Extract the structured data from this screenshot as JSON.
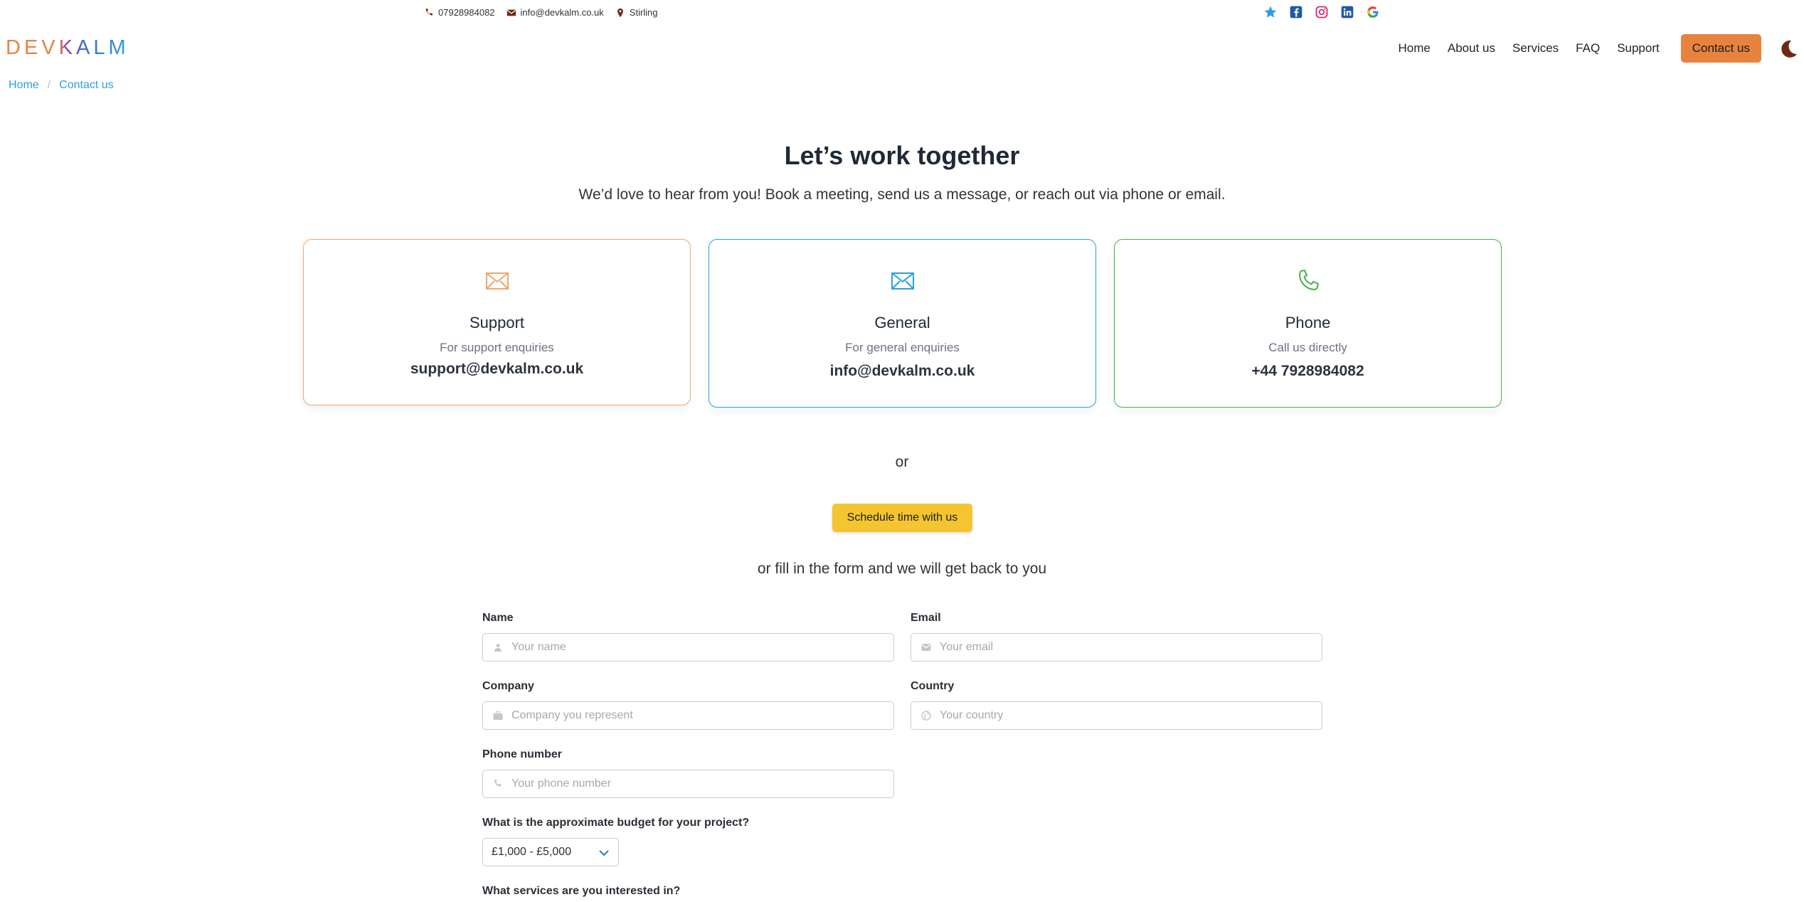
{
  "topbar": {
    "phone": "07928984082",
    "email": "info@devkalm.co.uk",
    "location": "Stirling",
    "social_icons": [
      "star-icon",
      "facebook-icon",
      "instagram-icon",
      "linkedin-icon",
      "google-icon"
    ]
  },
  "brand": {
    "logo_text": "DEVKALM"
  },
  "nav": {
    "items": [
      "Home",
      "About us",
      "Services",
      "FAQ",
      "Support"
    ],
    "cta": "Contact us",
    "theme_icon": "moon-icon"
  },
  "breadcrumb": {
    "home": "Home",
    "separator": "/",
    "current": "Contact us"
  },
  "hero": {
    "title": "Let’s work together",
    "subtitle": "We’d love to hear from you! Book a meeting, send us a message, or reach out via phone or email."
  },
  "cards": [
    {
      "title": "Support",
      "desc": "For support enquiries",
      "value": "support@devkalm.co.uk",
      "color": "#f0a66a",
      "icon": "envelope-icon"
    },
    {
      "title": "General",
      "desc": "For general enquiries",
      "value": "info@devkalm.co.uk",
      "color": "#2b9fe2",
      "icon": "envelope-icon"
    },
    {
      "title": "Phone",
      "desc": "Call us directly",
      "value": "+44 7928984082",
      "color": "#4cae4f",
      "icon": "phone-icon"
    }
  ],
  "or_text": "or",
  "schedule_button": "Schedule time with us",
  "form_intro": "or fill in the form and we will get back to you",
  "form": {
    "name_label": "Name",
    "name_placeholder": "Your name",
    "email_label": "Email",
    "email_placeholder": "Your email",
    "company_label": "Company",
    "company_placeholder": "Company you represent",
    "country_label": "Country",
    "country_placeholder": "Your country",
    "phone_label": "Phone number",
    "phone_placeholder": "Your phone number",
    "budget_label": "What is the approximate budget for your project?",
    "budget_value": "£1,000 - £5,000",
    "services_label": "What services are you interested in?"
  },
  "colors": {
    "accent": "#e8833f",
    "link": "#2b9fe2",
    "schedule": "#f4c531"
  }
}
